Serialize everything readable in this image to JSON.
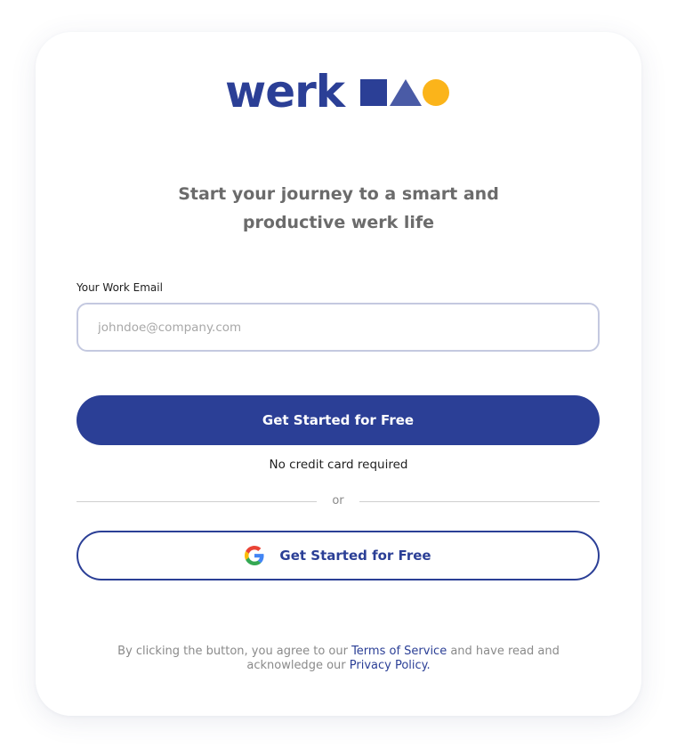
{
  "brand": {
    "name": "werk",
    "colors": {
      "primary": "#2b3f96",
      "shape_square": "#2b3f96",
      "shape_triangle": "#4a5ba6",
      "shape_circle": "#fbb41a"
    },
    "shape_icons": [
      "square-icon",
      "triangle-icon",
      "circle-icon"
    ]
  },
  "headline": {
    "line1": "Start your journey to a smart and",
    "line2": "productive werk life"
  },
  "email": {
    "label": "Your Work Email",
    "placeholder": "johndoe@company.com",
    "value": ""
  },
  "primary_button": {
    "label": "Get Started for Free"
  },
  "note": "No credit card required",
  "divider": {
    "text": "or"
  },
  "google_button": {
    "label": "Get Started for Free",
    "icon": "google-icon"
  },
  "legal": {
    "prefix": "By clicking the button, you agree to our",
    "terms_link": "Terms of Service",
    "middle": "and have read and acknowledge our",
    "privacy_link": "Privacy Policy."
  }
}
